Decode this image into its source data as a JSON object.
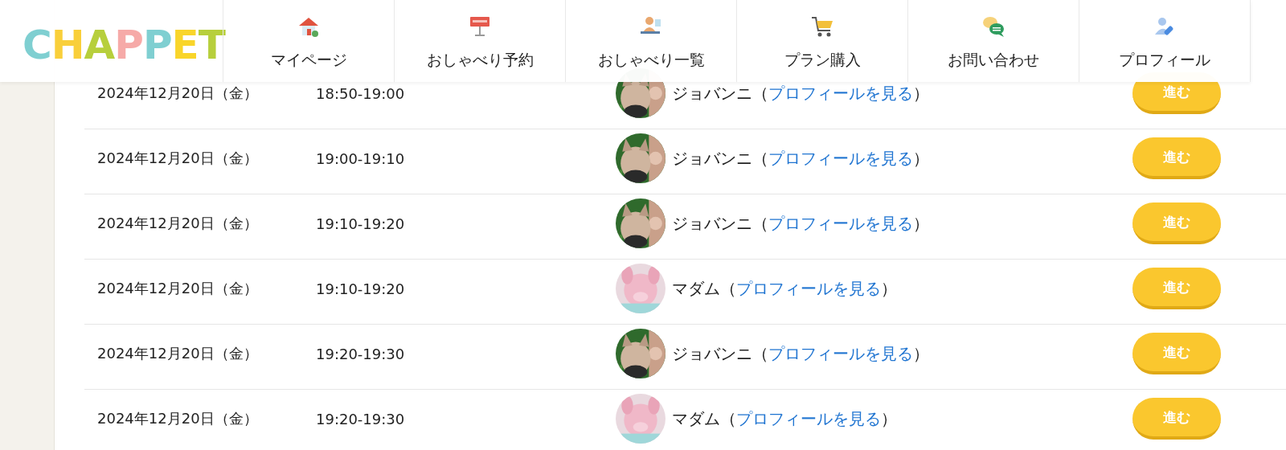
{
  "header": {
    "logo": "CHAPPET",
    "nav": [
      {
        "label": "マイページ"
      },
      {
        "label": "おしゃべり予約"
      },
      {
        "label": "おしゃべり一覧"
      },
      {
        "label": "プラン購入"
      },
      {
        "label": "お問い合わせ"
      },
      {
        "label": "プロフィール"
      }
    ]
  },
  "rows": [
    {
      "date": "2024年12月20日（金）",
      "time": "18:50-19:00",
      "avatar": {
        "kind": "cat"
      },
      "host_prefix": "ジョバンニ（",
      "profile_link": "プロフィールを見る",
      "host_suffix": "）",
      "button": "進む"
    },
    {
      "date": "2024年12月20日（金）",
      "time": "19:00-19:10",
      "avatar": {
        "kind": "cat"
      },
      "host_prefix": "ジョバンニ（",
      "profile_link": "プロフィールを見る",
      "host_suffix": "）",
      "button": "進む"
    },
    {
      "date": "2024年12月20日（金）",
      "time": "19:10-19:20",
      "avatar": {
        "kind": "cat"
      },
      "host_prefix": "ジョバンニ（",
      "profile_link": "プロフィールを見る",
      "host_suffix": "）",
      "button": "進む"
    },
    {
      "date": "2024年12月20日（金）",
      "time": "19:10-19:20",
      "avatar": {
        "kind": "plush"
      },
      "host_prefix": "マダム（",
      "profile_link": "プロフィールを見る",
      "host_suffix": "）",
      "button": "進む"
    },
    {
      "date": "2024年12月20日（金）",
      "time": "19:20-19:30",
      "avatar": {
        "kind": "cat"
      },
      "host_prefix": "ジョバンニ（",
      "profile_link": "プロフィールを見る",
      "host_suffix": "）",
      "button": "進む"
    },
    {
      "date": "2024年12月20日（金）",
      "time": "19:20-19:30",
      "avatar": {
        "kind": "plush"
      },
      "host_prefix": "マダム（",
      "profile_link": "プロフィールを見る",
      "host_suffix": "）",
      "button": "進む"
    }
  ]
}
